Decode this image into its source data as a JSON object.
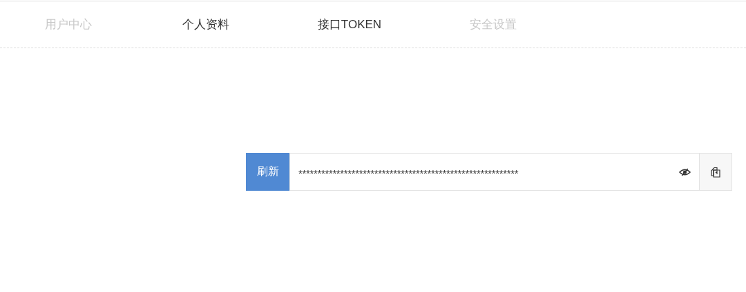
{
  "tabs": [
    {
      "label": "用户中心",
      "disabled": true
    },
    {
      "label": "个人资料",
      "disabled": false
    },
    {
      "label": "接口TOKEN",
      "disabled": false
    },
    {
      "label": "安全设置",
      "disabled": true
    }
  ],
  "token": {
    "refresh_label": "刷新",
    "value": "**********************************************************",
    "revealed": false
  }
}
